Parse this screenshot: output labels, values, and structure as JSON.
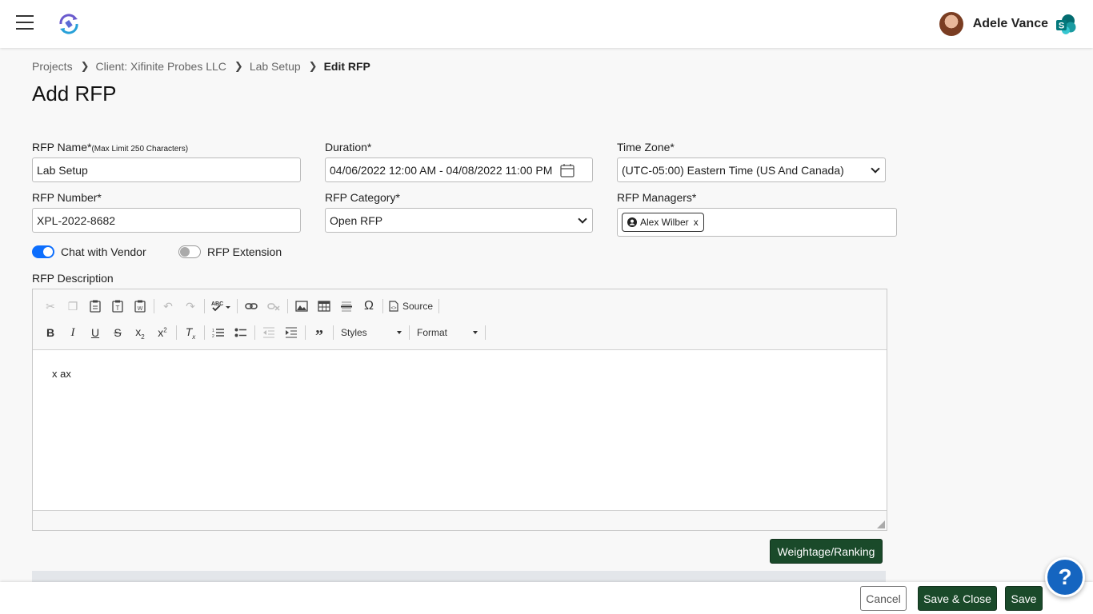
{
  "header": {
    "menu_icon": "hamburger-icon",
    "logo_icon": "app-logo",
    "user_name": "Adele Vance",
    "app_icon": "sharepoint-icon"
  },
  "breadcrumb": {
    "items": [
      "Projects",
      "Client: Xifinite Probes LLC",
      "Lab Setup"
    ],
    "current": "Edit RFP"
  },
  "page": {
    "title": "Add RFP"
  },
  "form": {
    "rfp_name": {
      "label": "RFP Name*",
      "hint": "(Max Limit 250 Characters)",
      "value": "Lab Setup"
    },
    "duration": {
      "label": "Duration*",
      "value": "04/06/2022 12:00 AM - 04/08/2022 11:00 PM"
    },
    "time_zone": {
      "label": "Time Zone*",
      "value": "(UTC-05:00) Eastern Time (US And Canada)"
    },
    "rfp_number": {
      "label": "RFP Number*",
      "value": "XPL-2022-8682"
    },
    "rfp_category": {
      "label": "RFP Category*",
      "value": "Open RFP"
    },
    "rfp_managers": {
      "label": "RFP Managers*",
      "chips": [
        {
          "name": "Alex Wilber",
          "remove": "x"
        }
      ]
    },
    "toggles": {
      "chat_with_vendor": {
        "label": "Chat with Vendor",
        "on": true
      },
      "rfp_extension": {
        "label": "RFP Extension",
        "on": false
      }
    },
    "description": {
      "label": "RFP Description",
      "content": "x ax",
      "toolbar": {
        "source_label": "Source",
        "styles_label": "Styles",
        "format_label": "Format"
      }
    }
  },
  "buttons": {
    "weightage": "Weightage/Ranking",
    "cancel": "Cancel",
    "save_close": "Save & Close",
    "save": "Save",
    "help": "?"
  },
  "colors": {
    "primary_green": "#1a4a2a",
    "toggle_on": "#0d6efd",
    "help_blue": "#1565c0"
  }
}
